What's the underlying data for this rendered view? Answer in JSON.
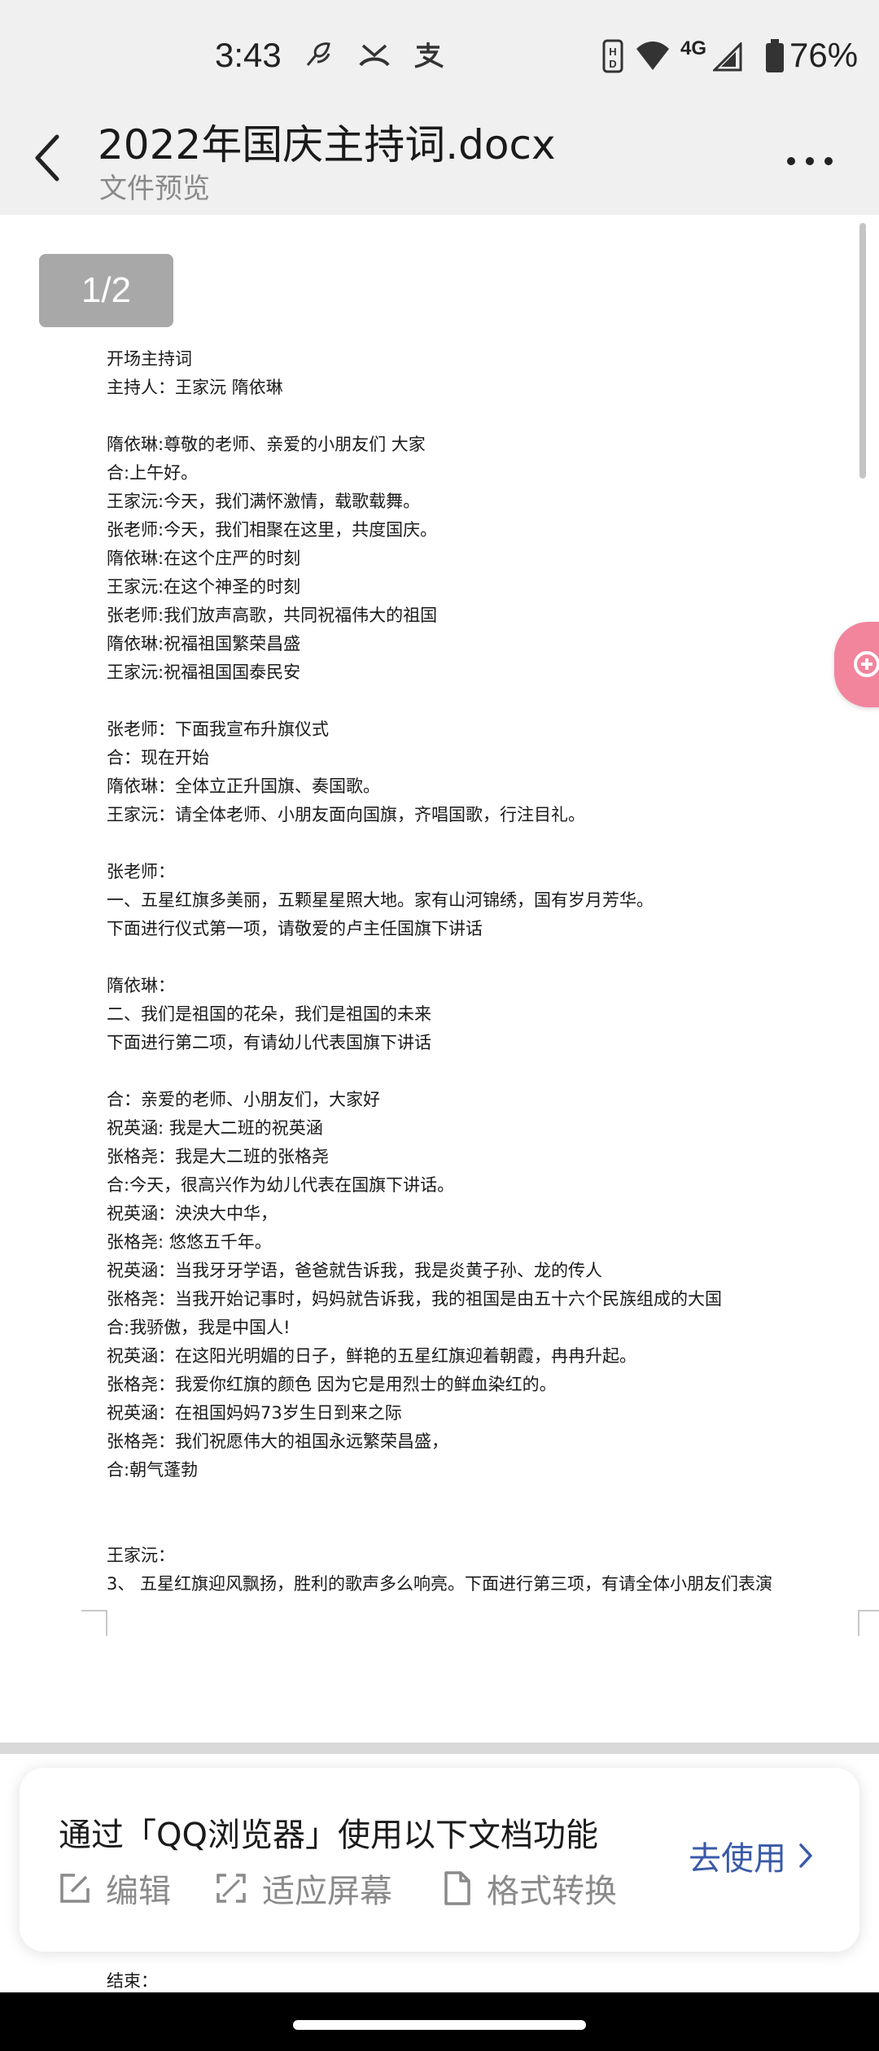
{
  "status_bar": {
    "time": "3:43",
    "network": "4G",
    "battery": "76%"
  },
  "header": {
    "title": "2022年国庆主持词.docx",
    "subtitle": "文件预览"
  },
  "viewer": {
    "page_counter": "1/2",
    "lines": [
      "开场主持词",
      "主持人：王家沅  隋依琳",
      "",
      "隋依琳:尊敬的老师、亲爱的小朋友们  大家",
      "合:上午好。",
      "王家沅:今天，我们满怀激情，载歌载舞。",
      "张老师:今天，我们相聚在这里，共度国庆。",
      "隋依琳:在这个庄严的时刻",
      "王家沅:在这个神圣的时刻",
      "张老师:我们放声高歌，共同祝福伟大的祖国",
      "隋依琳:祝福祖国繁荣昌盛",
      "王家沅:祝福祖国国泰民安",
      "",
      "张老师：下面我宣布升旗仪式",
      "合：现在开始",
      "隋依琳：全体立正升国旗、奏国歌。",
      "王家沅：请全体老师、小朋友面向国旗，齐唱国歌，行注目礼。",
      "",
      "张老师：",
      "一、五星红旗多美丽，五颗星星照大地。家有山河锦绣，国有岁月芳华。",
      "下面进行仪式第一项，请敬爱的卢主任国旗下讲话",
      "",
      "隋依琳：",
      "二、我们是祖国的花朵，我们是祖国的未来",
      "下面进行第二项，有请幼儿代表国旗下讲话",
      "",
      "合：亲爱的老师、小朋友们，大家好",
      "祝英涵:  我是大二班的祝英涵",
      "张格尧：我是大二班的张格尧",
      "合:今天，很高兴作为幼儿代表在国旗下讲话。",
      "祝英涵：泱泱大中华，",
      "张格尧:  悠悠五千年。",
      "祝英涵：当我牙牙学语，爸爸就告诉我，我是炎黄子孙、龙的传人",
      "张格尧：当我开始记事时，妈妈就告诉我，我的祖国是由五十六个民族组成的大国",
      "合:我骄傲，我是中国人!",
      "祝英涵：在这阳光明媚的日子，鲜艳的五星红旗迎着朝霞，冉冉升起。",
      "张格尧：我爱你红旗的颜色  因为它是用烈士的鲜血染红的。",
      "祝英涵：在祖国妈妈73岁生日到来之际",
      "张格尧：我们祝愿伟大的祖国永远繁荣昌盛，",
      "合:朝气蓬勃",
      "",
      "",
      "王家沅：",
      "3、  五星红旗迎风飘扬，胜利的歌声多么响亮。下面进行第三项，有请全体小朋友们表演"
    ],
    "next_page_peek": "结束："
  },
  "promo": {
    "title": "通过「QQ浏览器」使用以下文档功能",
    "features": {
      "edit": "编辑",
      "fit": "适应屏幕",
      "convert": "格式转换"
    },
    "use_label": "去使用"
  },
  "colors": {
    "header_bg": "#f0f0f0",
    "accent_blue": "#3a5aa8",
    "page_counter_bg": "#a8a8a8",
    "floating_tab": "#f2849c"
  }
}
